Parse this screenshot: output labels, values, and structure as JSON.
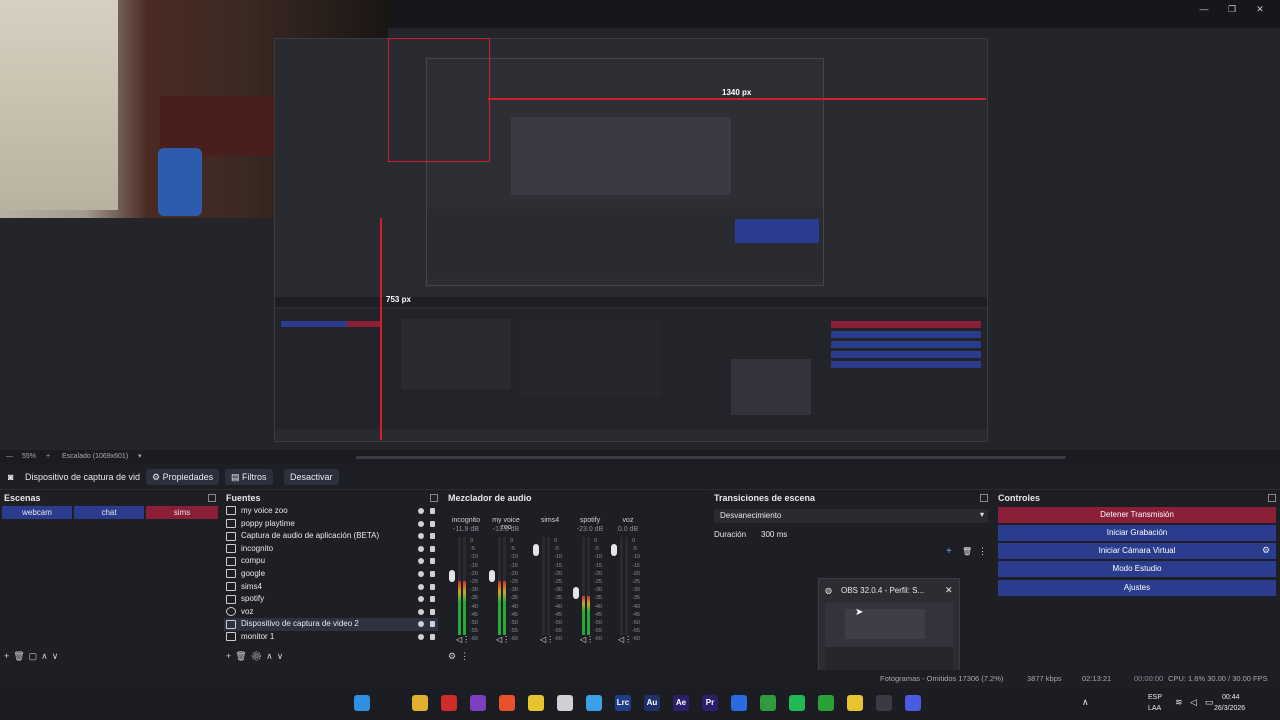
{
  "window_controls": {
    "minimize": "—",
    "maximize": "❐",
    "close": "✕"
  },
  "preview": {
    "width_label": "1340 px",
    "height_label": "753 px"
  },
  "statusbar": {
    "zoom": "55%",
    "plus": "+",
    "scaling": "Escalado (1069x601)"
  },
  "toolbar": {
    "source_name": "Dispositivo de captura de vid",
    "properties": "Propiedades",
    "filters": "Filtros",
    "deactivate": "Desactivar"
  },
  "scenes": {
    "title": "Escenas",
    "items": [
      {
        "label": "webcam",
        "color": "#2b3b8d"
      },
      {
        "label": "chat",
        "color": "#2b3b8d"
      },
      {
        "label": "sims",
        "color": "#8a1f37"
      }
    ]
  },
  "sources": {
    "title": "Fuentes",
    "items": [
      {
        "label": "my voice zoo"
      },
      {
        "label": "poppy playtime"
      },
      {
        "label": "Captura de audio de aplicación (BETA)"
      },
      {
        "label": "incognito"
      },
      {
        "label": "compu"
      },
      {
        "label": "google"
      },
      {
        "label": "sims4"
      },
      {
        "label": "spotify"
      },
      {
        "label": "voz"
      },
      {
        "label": "Dispositivo de captura de video 2"
      },
      {
        "label": "monitor 1"
      }
    ]
  },
  "mixer": {
    "title": "Mezclador de audio",
    "channels": [
      {
        "name": "incognito",
        "db": "-11.9 dB",
        "level": 0.55,
        "fader": 0.62
      },
      {
        "name": "my voice zoo",
        "db": "-13.0 dB",
        "level": 0.55,
        "fader": 0.62
      },
      {
        "name": "sims4",
        "db": "",
        "level": 0.0,
        "fader": 0.92
      },
      {
        "name": "spotify",
        "db": "-23.0 dB",
        "level": 0.4,
        "fader": 0.42
      },
      {
        "name": "voz",
        "db": "0.0 dB",
        "level": 0.0,
        "fader": 0.92
      }
    ],
    "scale": [
      "0",
      "-5",
      "-10",
      "-15",
      "-20",
      "-25",
      "-30",
      "-35",
      "-40",
      "-45",
      "-50",
      "-55",
      "-60"
    ]
  },
  "transitions": {
    "title": "Transiciones de escena",
    "selected": "Desvanecimiento",
    "duration_label": "Duración",
    "duration_value": "300 ms"
  },
  "controls": {
    "title": "Controles",
    "buttons": [
      {
        "label": "Detener Transmisión",
        "color": "#8a1f37"
      },
      {
        "label": "Iniciar Grabación",
        "color": "#2b3b8d"
      },
      {
        "label": "Iniciar Cámara Virtual",
        "color": "#2b3b8d"
      },
      {
        "label": "Modo Estudio",
        "color": "#2b3b8d"
      },
      {
        "label": "Ajustes",
        "color": "#2b3b8d"
      }
    ]
  },
  "popup": {
    "title": "OBS 32.0.4 - Perfil: S..."
  },
  "stats": {
    "frames": "Fotogramas - Omitidos 17306 (7.2%)",
    "bitrate": "3877 kbps",
    "live_time": "02:13:21",
    "rec_time": "00:00:00",
    "cpu": "CPU: 1.6% 30.00 / 30.00 FPS"
  },
  "taskbar": {
    "apps": [
      {
        "name": "windows-start-icon",
        "color": "#2f8fe0"
      },
      {
        "name": "search-icon",
        "color": "#1c1d22"
      },
      {
        "name": "file-explorer-icon",
        "color": "#e0b030"
      },
      {
        "name": "capcut-icon",
        "color": "#d02b2b"
      },
      {
        "name": "instagram-icon",
        "color": "#7c3fbf"
      },
      {
        "name": "brave-icon",
        "color": "#e8522a"
      },
      {
        "name": "chrome-icon",
        "color": "#e8c330"
      },
      {
        "name": "capcut-alt-icon",
        "color": "#cfcfd4"
      },
      {
        "name": "notes-icon",
        "color": "#3aa0e8"
      },
      {
        "name": "lrc-icon",
        "text": "Lrc",
        "color": "#1f3e8a"
      },
      {
        "name": "audition-icon",
        "text": "Au",
        "color": "#1f2f6a"
      },
      {
        "name": "after-effects-icon",
        "text": "Ae",
        "color": "#2a1f6a"
      },
      {
        "name": "premiere-icon",
        "text": "Pr",
        "color": "#2a1f6a"
      },
      {
        "name": "store-icon",
        "color": "#2b6be0"
      },
      {
        "name": "xbox-icon",
        "color": "#2f9a3f"
      },
      {
        "name": "spotify-icon",
        "color": "#1fb955"
      },
      {
        "name": "sims-icon",
        "color": "#2aa03a"
      },
      {
        "name": "chrome-2-icon",
        "color": "#e8c330"
      },
      {
        "name": "obs-icon",
        "color": "#3a3b42"
      },
      {
        "name": "discord-app-icon",
        "color": "#4a5be0"
      }
    ],
    "lang": "ESP",
    "lang_sub": "LAA",
    "time": "00:44",
    "date": "26/3/2026"
  }
}
